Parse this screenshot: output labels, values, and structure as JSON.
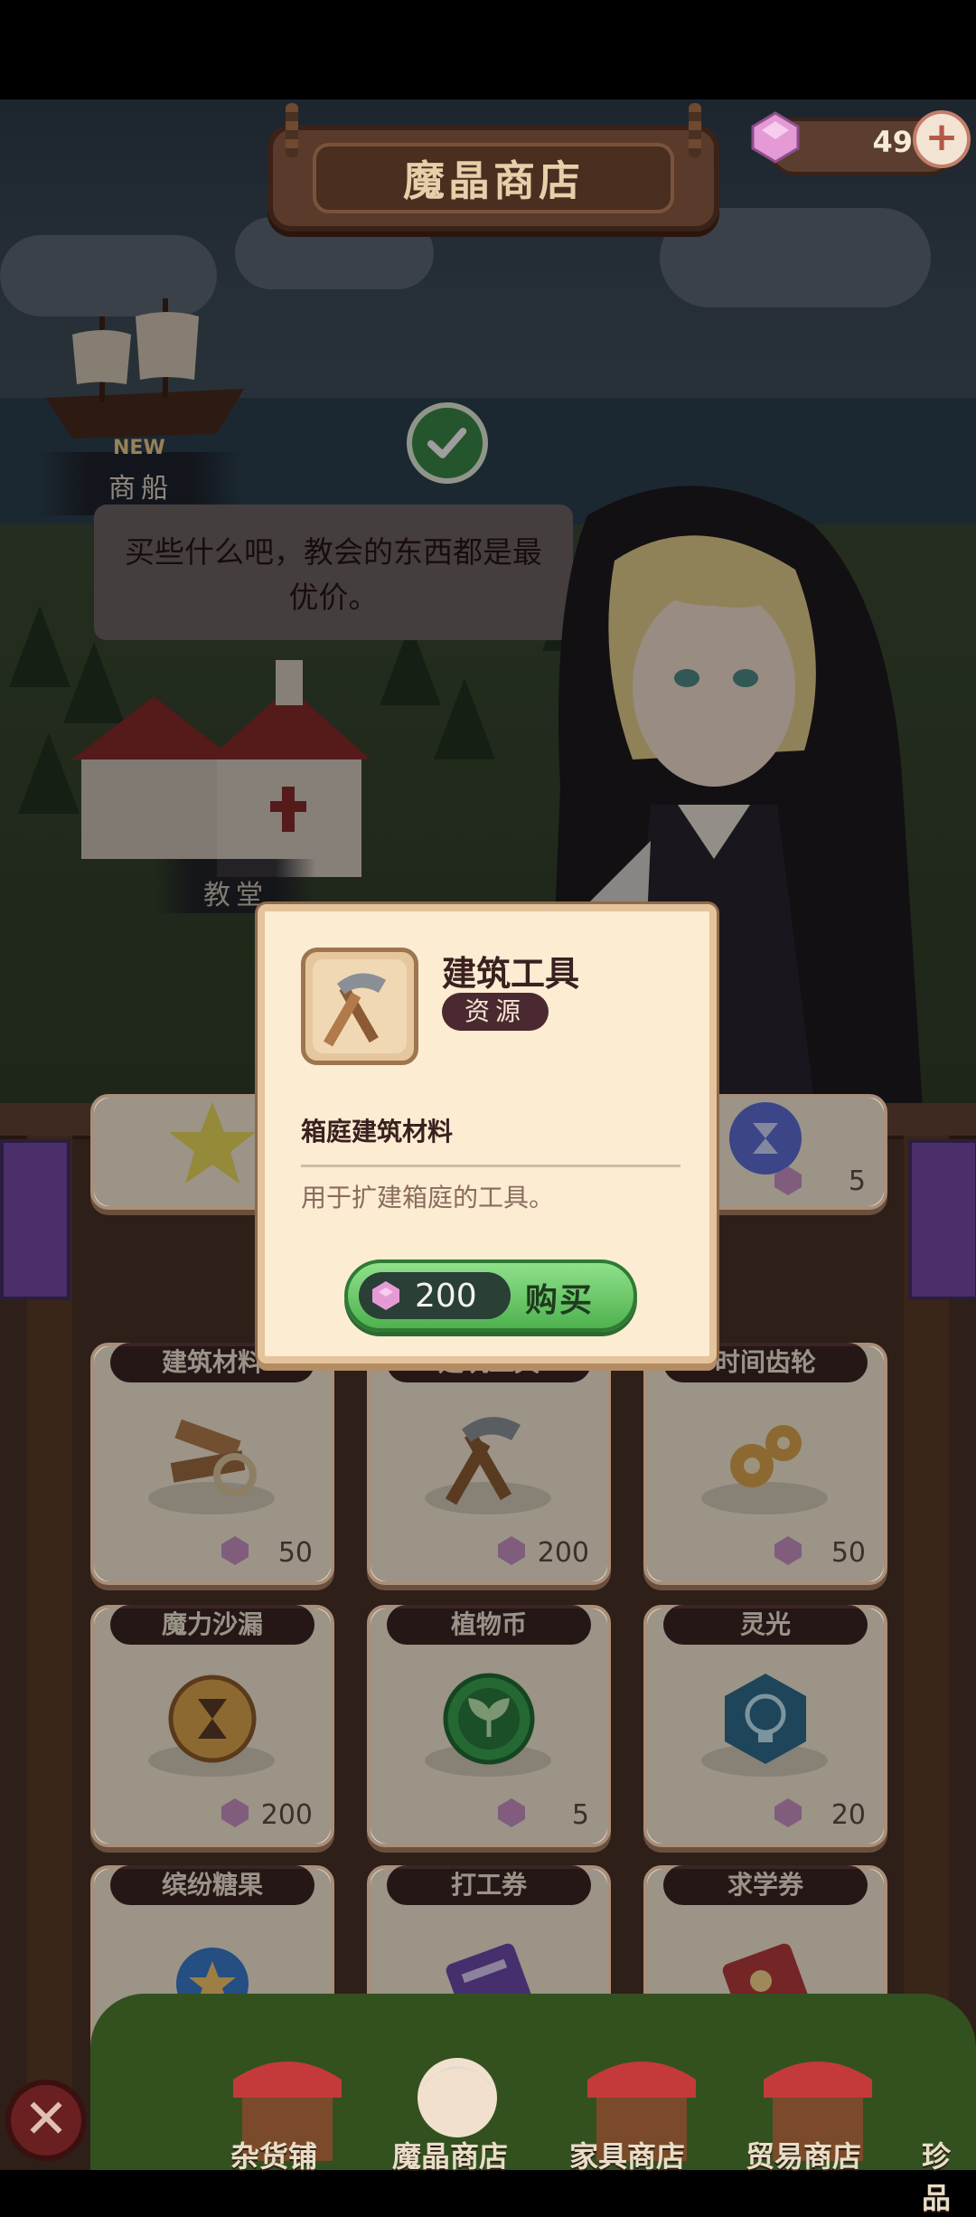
{
  "header": {
    "title": "魔晶商店"
  },
  "currency": {
    "gems": "49",
    "add_icon": "plus-icon"
  },
  "scene": {
    "ship": {
      "new_tag": "NEW",
      "label": "商船"
    },
    "speech": "买些什么吧，教会的东西都是最优价。",
    "church_label": "教堂"
  },
  "shop": {
    "row1": [
      {
        "title": "",
        "price": "",
        "icon": "star-icon"
      },
      {
        "title": "",
        "price": "",
        "icon": ""
      },
      {
        "title": "",
        "price": "5",
        "icon": "hourglass-orb-icon"
      }
    ],
    "row2": [
      {
        "title": "建筑材料",
        "price": "50",
        "icon": "building-materials-icon"
      },
      {
        "title": "建筑工具",
        "price": "200",
        "icon": "hammer-icon"
      },
      {
        "title": "时间齿轮",
        "price": "50",
        "icon": "gears-icon"
      }
    ],
    "row3": [
      {
        "title": "魔力沙漏",
        "price": "200",
        "icon": "hourglass-coin-icon"
      },
      {
        "title": "植物币",
        "price": "5",
        "icon": "plant-coin-icon"
      },
      {
        "title": "灵光",
        "price": "20",
        "icon": "lightbulb-gem-icon"
      }
    ],
    "row4": [
      {
        "title": "缤纷糖果",
        "price": "",
        "icon": "candy-icon"
      },
      {
        "title": "打工券",
        "price": "",
        "icon": "work-ticket-icon"
      },
      {
        "title": "求学券",
        "price": "",
        "icon": "study-ticket-icon"
      }
    ]
  },
  "nav": {
    "items": [
      {
        "label": "杂货铺"
      },
      {
        "label": "魔晶商店"
      },
      {
        "label": "家具商店"
      },
      {
        "label": "贸易商店"
      },
      {
        "label": "珍品"
      }
    ]
  },
  "popup": {
    "name": "建筑工具",
    "tag": "资源",
    "subtitle": "箱庭建筑材料",
    "description": "用于扩建箱庭的工具。",
    "price": "200",
    "buy_label": "购买"
  },
  "colors": {
    "accent_green": "#4fb24f",
    "gem_pink": "#e59ad6",
    "board_brown": "#2e1f18"
  }
}
